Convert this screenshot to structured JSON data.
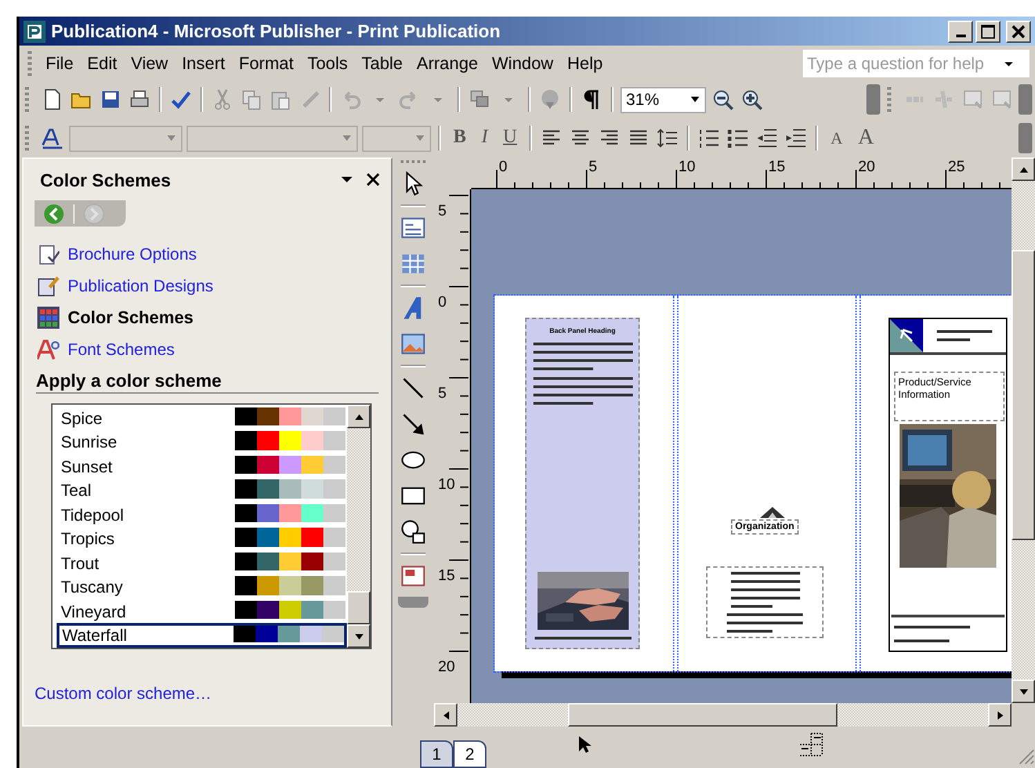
{
  "window": {
    "title": "Publication4 - Microsoft Publisher - Print Publication"
  },
  "menu": [
    {
      "label": "File"
    },
    {
      "label": "Edit"
    },
    {
      "label": "View"
    },
    {
      "label": "Insert"
    },
    {
      "label": "Format"
    },
    {
      "label": "Tools"
    },
    {
      "label": "Table"
    },
    {
      "label": "Arrange"
    },
    {
      "label": "Window"
    },
    {
      "label": "Help"
    }
  ],
  "help_search": {
    "placeholder": "Type a question for help"
  },
  "zoom": {
    "value": "31%"
  },
  "format_buttons": [
    {
      "label": "B"
    },
    {
      "label": "I"
    },
    {
      "label": "U"
    }
  ],
  "font_size_buttons": [
    {
      "label": "A",
      "kind": "decrease"
    },
    {
      "label": "A",
      "kind": "increase"
    }
  ],
  "task_pane": {
    "title": "Color Schemes",
    "back_disabled": false,
    "forward_disabled": true,
    "links": [
      {
        "label": "Brochure Options",
        "selected": false
      },
      {
        "label": "Publication Designs",
        "selected": false
      },
      {
        "label": "Color Schemes",
        "selected": true
      },
      {
        "label": "Font Schemes",
        "selected": false
      }
    ],
    "section_heading": "Apply a color scheme",
    "schemes": [
      {
        "name": "Spice",
        "selected": false,
        "swatches": [
          {
            "color": "#000000"
          },
          {
            "color": "#663300"
          },
          {
            "color": "#ff9999"
          },
          {
            "color": "#e0d8d0"
          },
          {
            "color": "#cccccc"
          }
        ]
      },
      {
        "name": "Sunrise",
        "selected": false,
        "swatches": [
          {
            "color": "#000000"
          },
          {
            "color": "#ff0000"
          },
          {
            "color": "#ffff00"
          },
          {
            "color": "#ffcccc"
          },
          {
            "color": "#cccccc"
          }
        ]
      },
      {
        "name": "Sunset",
        "selected": false,
        "swatches": [
          {
            "color": "#000000"
          },
          {
            "color": "#cc0033"
          },
          {
            "color": "#cc99ff"
          },
          {
            "color": "#ffcc33"
          },
          {
            "color": "#cccccc"
          }
        ]
      },
      {
        "name": "Teal",
        "selected": false,
        "swatches": [
          {
            "color": "#000000"
          },
          {
            "color": "#336666"
          },
          {
            "color": "#aabbbb"
          },
          {
            "color": "#d0dcdc"
          },
          {
            "color": "#cccccc"
          }
        ]
      },
      {
        "name": "Tidepool",
        "selected": false,
        "swatches": [
          {
            "color": "#000000"
          },
          {
            "color": "#6666cc"
          },
          {
            "color": "#ff9999"
          },
          {
            "color": "#66ffcc"
          },
          {
            "color": "#cccccc"
          }
        ]
      },
      {
        "name": "Tropics",
        "selected": false,
        "swatches": [
          {
            "color": "#000000"
          },
          {
            "color": "#006699"
          },
          {
            "color": "#ffcc00"
          },
          {
            "color": "#ff0000"
          },
          {
            "color": "#cccccc"
          }
        ]
      },
      {
        "name": "Trout",
        "selected": false,
        "swatches": [
          {
            "color": "#000000"
          },
          {
            "color": "#336666"
          },
          {
            "color": "#ffcc33"
          },
          {
            "color": "#990000"
          },
          {
            "color": "#cccccc"
          }
        ]
      },
      {
        "name": "Tuscany",
        "selected": false,
        "swatches": [
          {
            "color": "#000000"
          },
          {
            "color": "#cc9900"
          },
          {
            "color": "#cccc99"
          },
          {
            "color": "#999966"
          },
          {
            "color": "#cccccc"
          }
        ]
      },
      {
        "name": "Vineyard",
        "selected": false,
        "swatches": [
          {
            "color": "#000000"
          },
          {
            "color": "#330066"
          },
          {
            "color": "#cccc00"
          },
          {
            "color": "#669999"
          },
          {
            "color": "#cccccc"
          }
        ]
      },
      {
        "name": "Waterfall",
        "selected": true,
        "swatches": [
          {
            "color": "#000000"
          },
          {
            "color": "#000099"
          },
          {
            "color": "#669999"
          },
          {
            "color": "#ccccee"
          },
          {
            "color": "#cccccc"
          }
        ]
      }
    ],
    "custom_link": "Custom color scheme…"
  },
  "rulers": {
    "horizontal": [
      "0",
      "5",
      "10",
      "15",
      "20",
      "25"
    ],
    "vertical": [
      "5",
      "0",
      "5",
      "10",
      "15",
      "20"
    ]
  },
  "brochure": {
    "back_heading": "Back Panel Heading",
    "organization": "Organization",
    "product_title": "Product/Service Information"
  },
  "page_tabs": [
    {
      "label": "1",
      "selected": true
    },
    {
      "label": "2",
      "selected": false
    }
  ]
}
